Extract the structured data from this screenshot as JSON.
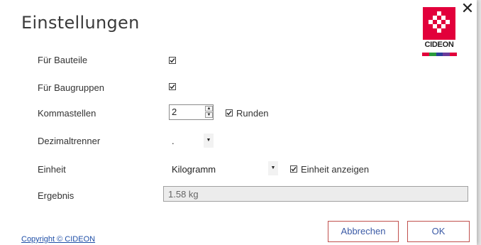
{
  "dialog": {
    "title": "Einstellungen",
    "close_glyph": "✕",
    "logo": {
      "text": "CIDEON",
      "colors": [
        "#e2003b",
        "#2a9a3c",
        "#2b3f9c",
        "#6a3a9a",
        "#e2003b"
      ]
    }
  },
  "settings": {
    "fuer_bauteile": {
      "label": "Für Bauteile",
      "checked": true
    },
    "fuer_baugruppen": {
      "label": "Für Baugruppen",
      "checked": true
    },
    "kommastellen": {
      "label": "Kommastellen",
      "value": "2",
      "runden_label": "Runden",
      "runden_checked": true
    },
    "dezimaltrenner": {
      "label": "Dezimaltrenner",
      "value": "."
    },
    "einheit": {
      "label": "Einheit",
      "value": "Kilogramm",
      "anzeigen_label": "Einheit anzeigen",
      "anzeigen_checked": true
    },
    "ergebnis": {
      "label": "Ergebnis",
      "value": "1.58 kg"
    }
  },
  "footer": {
    "copyright": "Copyright © CIDEON",
    "cancel_label": "Abbrechen",
    "ok_label": "OK"
  },
  "icons": {
    "stepper_up": "▲",
    "stepper_down": "▼",
    "dropdown": "▼"
  }
}
